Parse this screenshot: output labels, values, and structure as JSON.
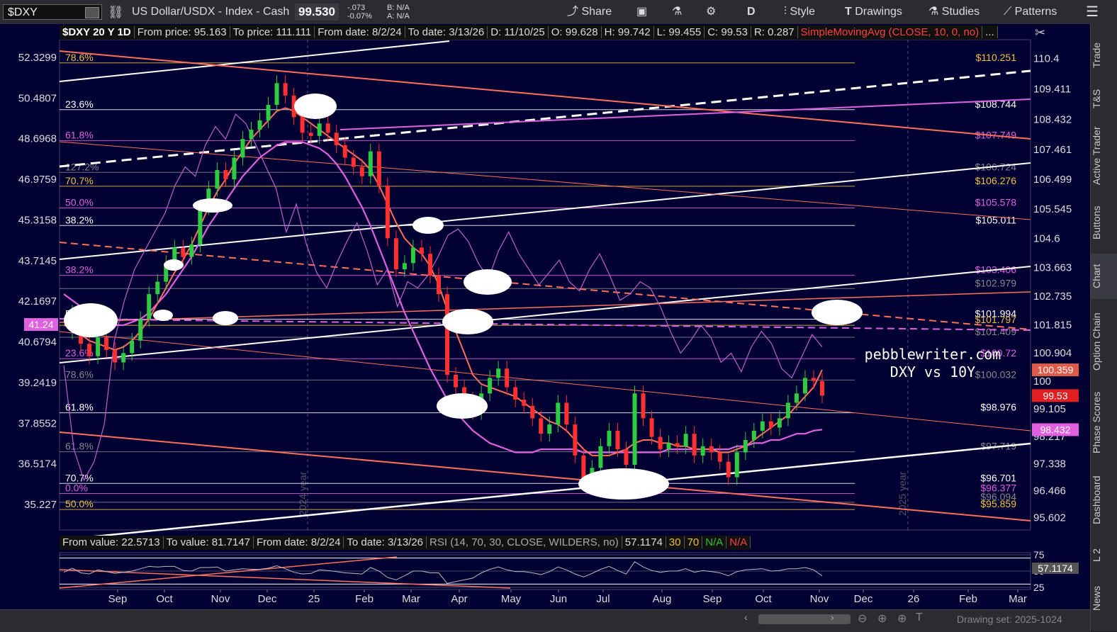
{
  "toolbar": {
    "symbol": "$DXY",
    "description": "US Dollar/USDX - Index - Cash",
    "last": "99.530",
    "change": "-.073",
    "change_pct": "-0.07%",
    "bid": "B: N/A",
    "ask": "A: N/A",
    "share": "Share",
    "period": "D",
    "style": "Style",
    "drawings": "Drawings",
    "studies": "Studies",
    "patterns": "Patterns"
  },
  "info": {
    "title": "$DXY 20 Y 1D",
    "from_price": "From price: 95.163",
    "to_price": "To price: 111.111",
    "from_date": "From date: 8/2/24",
    "to_date": "To date: 3/13/26",
    "d": "D: 11/10/25",
    "o": "O: 99.628",
    "h": "H: 99.742",
    "l": "L: 99.455",
    "c": "C: 99.53",
    "r": "R: 0.287",
    "sma": "SimpleMovingAvg (CLOSE, 10, 0, no)"
  },
  "rsi_info": {
    "from_value": "From value: 22.5713",
    "to_value": "To value: 81.7147",
    "from_date": "From date: 8/2/24",
    "to_date": "To date: 3/13/26",
    "study": "RSI (14, 70, 30, CLOSE, WILDERS, no)",
    "value": "57.1174",
    "ob": "30",
    "os": "70",
    "na1": "N/A",
    "na2": "N/A"
  },
  "sidebar_tabs": [
    "Trade",
    "T&S",
    "Active Trader",
    "Buttons",
    "Chart",
    "Option Chain",
    "Phase Scores",
    "Dashboard",
    "L 2",
    "News"
  ],
  "drawing_set": "Drawing set: 2025-1024",
  "watermark": [
    "pebblewriter.com",
    "DXY vs 10Y"
  ],
  "chart_data": {
    "type": "line",
    "title": "$DXY 20 Y 1D",
    "x_labels": [
      "Sep",
      "Oct",
      "Nov",
      "Dec",
      "25",
      "Feb",
      "Mar",
      "Apr",
      "May",
      "Jun",
      "Jul",
      "Aug",
      "Sep",
      "Oct",
      "Nov",
      "Dec",
      "26",
      "Feb",
      "Mar"
    ],
    "year_labels": [
      "2024 year",
      "2025 year"
    ],
    "right_axis": [
      "110.4",
      "109.411",
      "108.432",
      "107.461",
      "106.499",
      "105.545",
      "104.6",
      "103.663",
      "102.735",
      "101.815",
      "100.904",
      "100",
      "99.105",
      "98.217",
      "97.338",
      "96.466",
      "95.602"
    ],
    "left_axis": [
      "52.3299",
      "50.4807",
      "48.6968",
      "46.9759",
      "45.3158",
      "43.7145",
      "42.1697",
      "40.6794",
      "39.2419",
      "37.8552",
      "36.5174",
      "35.227"
    ],
    "ylim_right": [
      95.2,
      111.0
    ],
    "price_tags": [
      {
        "label": "100.359",
        "value": 100.359,
        "color": "#e05a4a"
      },
      {
        "label": "99.53",
        "value": 99.53,
        "color": "#e02020"
      },
      {
        "label": "98.432",
        "value": 98.432,
        "color": "#e060e0"
      }
    ],
    "left_tag": "41.24",
    "rsi_axis": [
      "75",
      "50",
      "25"
    ],
    "rsi_tag": "57.1174",
    "level_labels": [
      {
        "text": "$110.251",
        "value": 110.251,
        "color": "#f0c040"
      },
      {
        "text": "$108.744",
        "value": 108.744,
        "color": "#ffffff"
      },
      {
        "text": "$107.749",
        "value": 107.749,
        "color": "#e060e0"
      },
      {
        "text": "$106.724",
        "value": 106.724,
        "color": "#888888"
      },
      {
        "text": "$106.276",
        "value": 106.276,
        "color": "#f0c040"
      },
      {
        "text": "$105.578",
        "value": 105.578,
        "color": "#e060e0"
      },
      {
        "text": "$105.011",
        "value": 105.011,
        "color": "#ffffff"
      },
      {
        "text": "$103.406",
        "value": 103.406,
        "color": "#e060e0"
      },
      {
        "text": "$102.979",
        "value": 102.979,
        "color": "#888888"
      },
      {
        "text": "$101.994",
        "value": 101.994,
        "color": "#ffffff"
      },
      {
        "text": "$101.797",
        "value": 101.797,
        "color": "#f0c040"
      },
      {
        "text": "$101.409",
        "value": 101.409,
        "color": "#888888"
      },
      {
        "text": "$100.72",
        "value": 100.72,
        "color": "#e060e0"
      },
      {
        "text": "$100.032",
        "value": 100.032,
        "color": "#888888"
      },
      {
        "text": "$98.976",
        "value": 98.976,
        "color": "#ffffff"
      },
      {
        "text": "$97.719",
        "value": 97.719,
        "color": "#888888"
      },
      {
        "text": "$96.701",
        "value": 96.701,
        "color": "#ffffff"
      },
      {
        "text": "$96.377",
        "value": 96.377,
        "color": "#e060e0"
      },
      {
        "text": "$96.094",
        "value": 96.094,
        "color": "#888888"
      },
      {
        "text": "$95.859",
        "value": 95.859,
        "color": "#f0c040"
      }
    ],
    "fib_labels": [
      {
        "text": "78.6%",
        "value": 110.251,
        "color": "#f0c040"
      },
      {
        "text": "23.6%",
        "value": 108.744,
        "color": "#ffffff"
      },
      {
        "text": "61.8%",
        "value": 107.749,
        "color": "#e060e0"
      },
      {
        "text": "127.2%",
        "value": 106.724,
        "color": "#888888"
      },
      {
        "text": "70.7%",
        "value": 106.276,
        "color": "#f0c040"
      },
      {
        "text": "50.0%",
        "value": 105.578,
        "color": "#e060e0"
      },
      {
        "text": "38.2%",
        "value": 105.011,
        "color": "#ffffff"
      },
      {
        "text": "38.2%",
        "value": 103.406,
        "color": "#e060e0"
      },
      {
        "text": "50.0%",
        "value": 101.994,
        "color": "#ffffff"
      },
      {
        "text": "23.6%",
        "value": 100.72,
        "color": "#e060e0"
      },
      {
        "text": "78.6%",
        "value": 100.032,
        "color": "#888888"
      },
      {
        "text": "61.8%",
        "value": 98.976,
        "color": "#ffffff"
      },
      {
        "text": "61.8%",
        "value": 97.719,
        "color": "#888888"
      },
      {
        "text": "70.7%",
        "value": 96.701,
        "color": "#ffffff"
      },
      {
        "text": "0.0%",
        "value": 96.377,
        "color": "#e060e0"
      },
      {
        "text": "50.0%",
        "value": 95.859,
        "color": "#f0c040"
      }
    ],
    "dxy_close": [
      101.6,
      102.2,
      101.2,
      100.8,
      101.4,
      101.0,
      100.6,
      100.9,
      101.3,
      102.0,
      102.8,
      103.2,
      103.8,
      104.3,
      104.0,
      104.4,
      105.6,
      106.2,
      106.8,
      106.5,
      107.2,
      107.8,
      108.1,
      108.4,
      108.9,
      109.6,
      109.2,
      108.5,
      108.0,
      107.9,
      108.3,
      108.0,
      107.6,
      107.2,
      106.9,
      106.6,
      107.4,
      106.3,
      104.6,
      103.6,
      103.8,
      104.3,
      104.1,
      103.4,
      102.8,
      100.2,
      99.8,
      99.4,
      99.0,
      99.6,
      100.1,
      100.4,
      99.8,
      99.4,
      99.2,
      98.8,
      98.3,
      98.6,
      99.3,
      98.6,
      97.6,
      96.8,
      97.2,
      97.9,
      98.4,
      97.8,
      97.3,
      99.6,
      98.8,
      98.2,
      97.8,
      98.0,
      97.9,
      98.3,
      97.6,
      97.9,
      97.7,
      97.4,
      96.9,
      97.7,
      98.1,
      98.4,
      98.7,
      98.5,
      98.8,
      99.3,
      99.6,
      100.1,
      100.0,
      99.53
    ],
    "sma10": [
      101.8,
      101.7,
      101.5,
      101.3,
      101.2,
      101.1,
      101.0,
      101.1,
      101.3,
      101.6,
      102.0,
      102.5,
      103.0,
      103.5,
      103.9,
      104.4,
      105.0,
      105.6,
      106.1,
      106.5,
      107.0,
      107.4,
      107.8,
      108.1,
      108.4,
      108.7,
      108.8,
      108.7,
      108.5,
      108.3,
      108.1,
      107.9,
      107.7,
      107.5,
      107.3,
      107.1,
      106.8,
      106.3,
      105.7,
      105.1,
      104.6,
      104.3,
      104.1,
      103.7,
      103.1,
      102.3,
      101.6,
      100.9,
      100.2,
      99.9,
      99.8,
      99.7,
      99.6,
      99.5,
      99.3,
      99.1,
      98.9,
      98.7,
      98.6,
      98.4,
      98.1,
      97.8,
      97.6,
      97.6,
      97.6,
      97.7,
      97.8,
      98.0,
      98.1,
      98.1,
      98.0,
      98.0,
      97.9,
      97.9,
      97.8,
      97.8,
      97.8,
      97.7,
      97.7,
      97.8,
      97.9,
      98.1,
      98.3,
      98.5,
      98.7,
      98.9,
      99.2,
      99.5,
      99.8,
      100.359
    ],
    "sma50": [
      102.8,
      102.6,
      102.4,
      102.2,
      102.0,
      101.9,
      101.8,
      101.8,
      101.9,
      102.0,
      102.2,
      102.5,
      102.8,
      103.2,
      103.6,
      104.0,
      104.5,
      105.0,
      105.4,
      105.8,
      106.2,
      106.6,
      106.9,
      107.2,
      107.4,
      107.6,
      107.7,
      107.7,
      107.7,
      107.6,
      107.5,
      107.3,
      107.0,
      106.6,
      106.1,
      105.6,
      105.0,
      104.3,
      103.6,
      102.9,
      102.2,
      101.6,
      101.0,
      100.4,
      99.9,
      99.4,
      99.0,
      98.7,
      98.4,
      98.2,
      98.0,
      97.9,
      97.8,
      97.7,
      97.7,
      97.7,
      97.8,
      97.8,
      97.8,
      97.8,
      97.8,
      97.7,
      97.7,
      97.7,
      97.7,
      97.7,
      97.7,
      97.7,
      97.7,
      97.7,
      97.7,
      97.8,
      97.8,
      97.8,
      97.8,
      97.8,
      97.8,
      97.8,
      97.8,
      97.9,
      97.9,
      98.0,
      98.0,
      98.1,
      98.1,
      98.2,
      98.3,
      98.3,
      98.4,
      98.432
    ],
    "tnx_overlay": [
      100.5,
      97.8,
      96.8,
      97.4,
      98.6,
      101.3,
      102.6,
      103.6,
      104.2,
      104.8,
      105.4,
      106.3,
      106.9,
      106.6,
      107.6,
      108.2,
      107.8,
      108.6,
      108.3,
      107.6,
      106.9,
      106.2,
      104.8,
      105.7,
      104.4,
      103.5,
      103.0,
      103.8,
      104.5,
      105.1,
      104.2,
      103.1,
      103.6,
      102.4,
      103.2,
      103.0,
      103.4,
      104.0,
      104.7,
      104.9,
      104.5,
      103.8,
      103.3,
      104.2,
      104.8,
      104.1,
      103.6,
      103.1,
      103.5,
      103.9,
      103.2,
      102.9,
      103.6,
      104.1,
      103.4,
      102.6,
      102.8,
      103.2,
      103.0,
      102.4,
      101.6,
      100.9,
      101.3,
      101.8,
      101.4,
      100.6,
      100.9,
      100.3,
      101.1,
      101.6,
      101.2,
      100.4,
      100.1,
      100.8,
      101.5,
      101.1
    ]
  }
}
